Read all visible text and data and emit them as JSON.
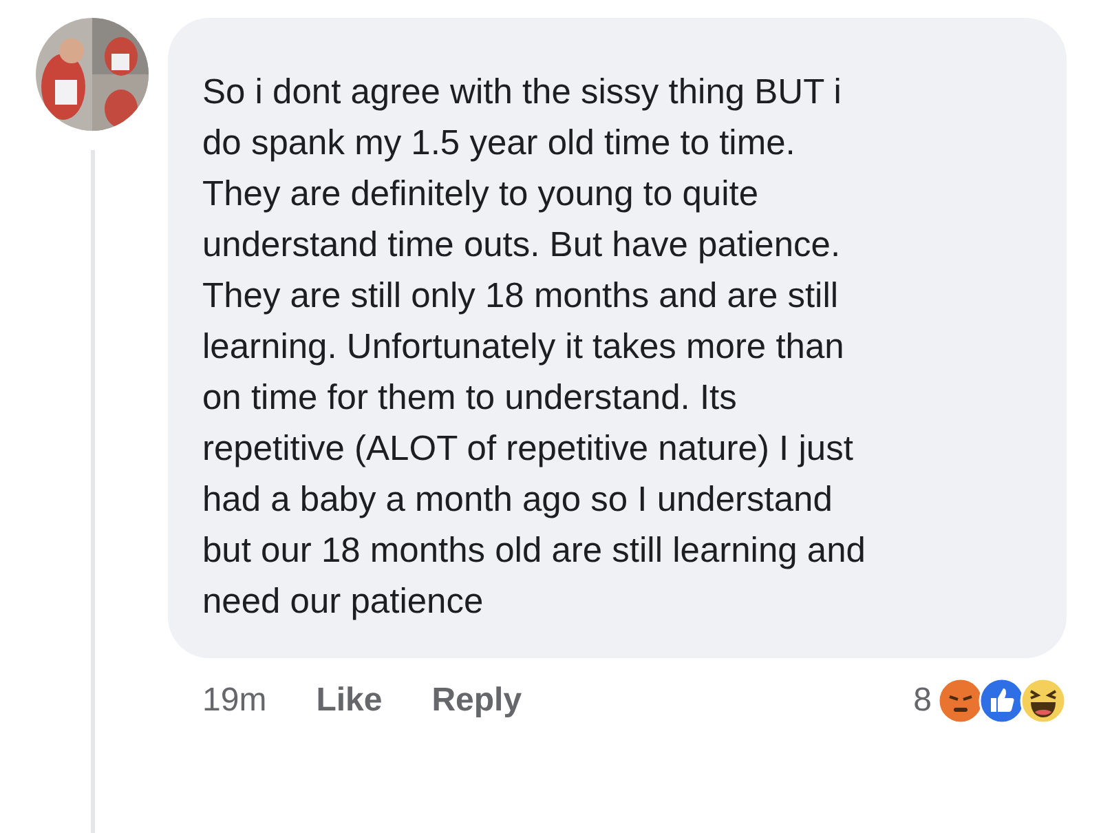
{
  "comment": {
    "avatar": {
      "kind": "picture"
    },
    "text": "So i dont agree with the sissy thing BUT i\ndo spank my 1.5 year old time to time.\nThey are definitely to young to quite\nunderstand time outs. But have patience.\nThey are still only 18 months and are still\nlearning. Unfortunately it takes more than\non time for them to understand. Its\nrepetitive (ALOT of repetitive nature) I just\nhad a baby a month ago so I understand\nbut our 18 months old are still learning and\nneed our patience",
    "time": "19m",
    "actions": [
      "Like",
      "Reply"
    ],
    "reaction_count": "8",
    "reactions": [
      {
        "kind": "angry"
      },
      {
        "kind": "like"
      },
      {
        "kind": "haha"
      }
    ]
  }
}
